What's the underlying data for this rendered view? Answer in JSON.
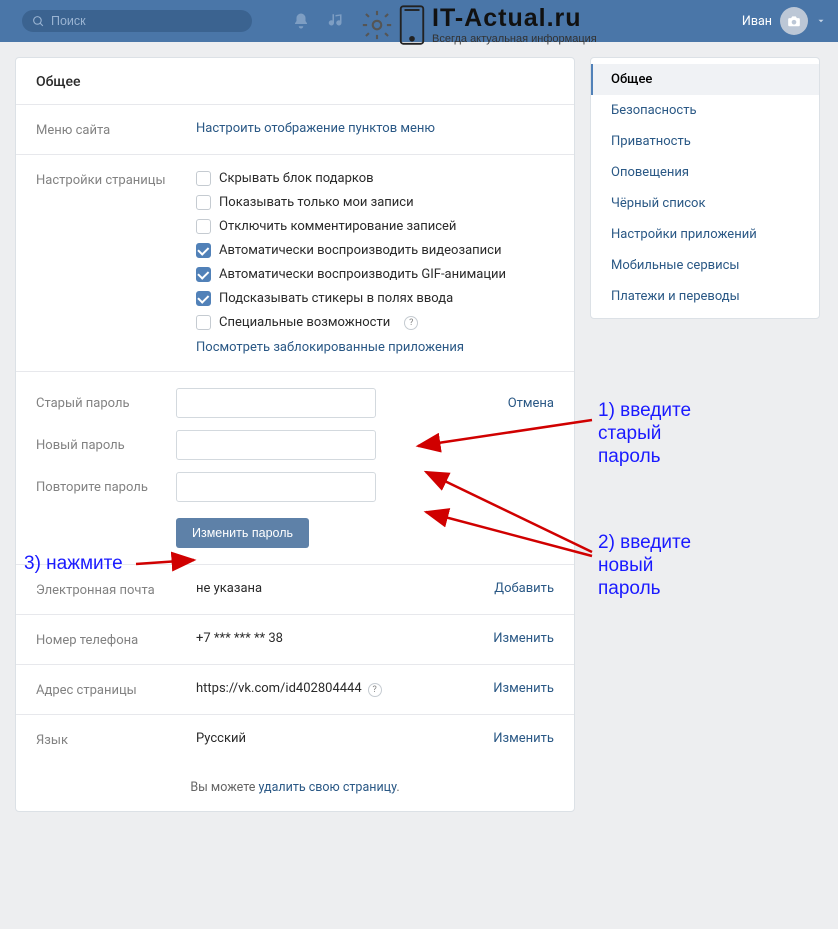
{
  "header": {
    "search_placeholder": "Поиск",
    "username": "Иван"
  },
  "watermark": {
    "title": "IT-Actual.ru",
    "subtitle": "Всегда актуальная информация"
  },
  "page_title": "Общее",
  "menu_row": {
    "label": "Меню сайта",
    "link": "Настроить отображение пунктов меню"
  },
  "settings_row": {
    "label": "Настройки страницы",
    "options": [
      {
        "text": "Скрывать блок подарков",
        "checked": false
      },
      {
        "text": "Показывать только мои записи",
        "checked": false
      },
      {
        "text": "Отключить комментирование записей",
        "checked": false
      },
      {
        "text": "Автоматически воспроизводить видеозаписи",
        "checked": true
      },
      {
        "text": "Автоматически воспроизводить GIF-анимации",
        "checked": true
      },
      {
        "text": "Подсказывать стикеры в полях ввода",
        "checked": true
      },
      {
        "text": "Специальные возможности",
        "checked": false,
        "help": true
      }
    ],
    "blocked_link": "Посмотреть заблокированные приложения"
  },
  "password": {
    "old_label": "Старый пароль",
    "new_label": "Новый пароль",
    "repeat_label": "Повторите пароль",
    "cancel": "Отмена",
    "button": "Изменить пароль"
  },
  "email_row": {
    "label": "Электронная почта",
    "value": "не указана",
    "action": "Добавить"
  },
  "phone_row": {
    "label": "Номер телефона",
    "value": "+7 *** *** ** 38",
    "action": "Изменить"
  },
  "url_row": {
    "label": "Адрес страницы",
    "value": "https://vk.com/id402804444",
    "action": "Изменить",
    "help": true
  },
  "lang_row": {
    "label": "Язык",
    "value": "Русский",
    "action": "Изменить"
  },
  "delete": {
    "prefix": "Вы можете ",
    "link": "удалить свою страницу",
    "suffix": "."
  },
  "sidebar": [
    "Общее",
    "Безопасность",
    "Приватность",
    "Оповещения",
    "Чёрный список",
    "Настройки приложений",
    "Мобильные сервисы",
    "Платежи и переводы"
  ],
  "annotations": {
    "a1": "1) введите старый пароль",
    "a2": "2) введите новый пароль",
    "a3": "3) нажмите"
  }
}
